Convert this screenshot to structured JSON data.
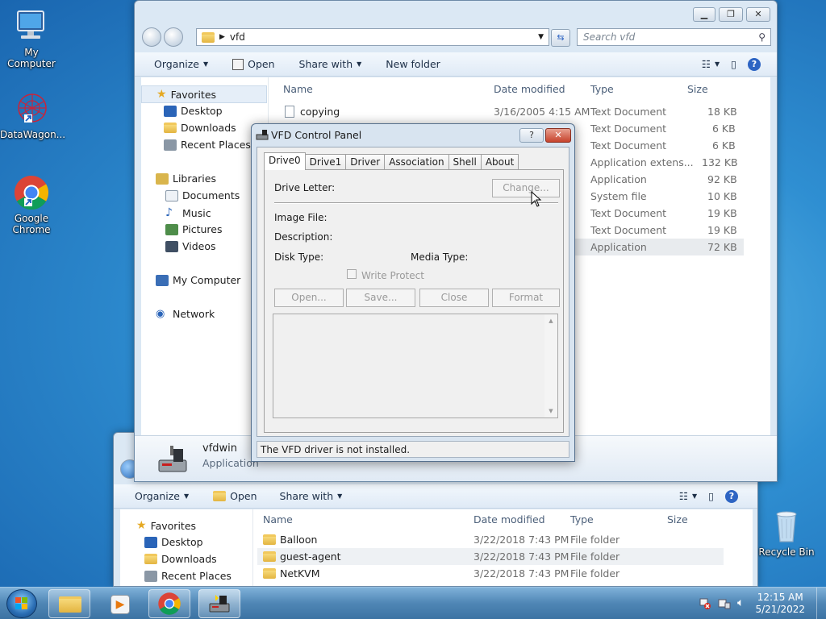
{
  "desktop": {
    "icons": [
      {
        "label": "My Computer"
      },
      {
        "label": "DataWagon..."
      },
      {
        "label": "Google Chrome"
      },
      {
        "label": "Recycle Bin"
      }
    ]
  },
  "explorer_top": {
    "address": "vfd",
    "search_placeholder": "Search vfd",
    "toolbar": {
      "organize": "Organize",
      "open": "Open",
      "share": "Share with",
      "new_folder": "New folder"
    },
    "nav": {
      "favorites": "Favorites",
      "desktop": "Desktop",
      "downloads": "Downloads",
      "recent": "Recent Places",
      "libraries": "Libraries",
      "documents": "Documents",
      "music": "Music",
      "pictures": "Pictures",
      "videos": "Videos",
      "my_computer": "My Computer",
      "network": "Network"
    },
    "columns": {
      "name": "Name",
      "date": "Date modified",
      "type": "Type",
      "size": "Size"
    },
    "rows": [
      {
        "name": "copying",
        "date": "3/16/2005 4:15 AM",
        "type": "Text Document",
        "size": "18 KB"
      },
      {
        "name": "",
        "date": "",
        "type": "Text Document",
        "size": "6 KB"
      },
      {
        "name": "",
        "date": "",
        "type": "Text Document",
        "size": "6 KB"
      },
      {
        "name": "",
        "date": "",
        "type": "Application extens...",
        "size": "132 KB"
      },
      {
        "name": "",
        "date": "",
        "type": "Application",
        "size": "92 KB"
      },
      {
        "name": "",
        "date": "",
        "type": "System file",
        "size": "10 KB"
      },
      {
        "name": "",
        "date": "",
        "type": "Text Document",
        "size": "19 KB"
      },
      {
        "name": "",
        "date": "",
        "type": "Text Document",
        "size": "19 KB"
      },
      {
        "name": "",
        "date": "",
        "type": "Application",
        "size": "72 KB"
      }
    ],
    "details": {
      "name": "vfdwin",
      "type": "Application"
    }
  },
  "explorer_bottom": {
    "toolbar": {
      "organize": "Organize",
      "open": "Open",
      "share": "Share with"
    },
    "nav": {
      "favorites": "Favorites",
      "desktop": "Desktop",
      "downloads": "Downloads",
      "recent": "Recent Places"
    },
    "columns": {
      "name": "Name",
      "date": "Date modified",
      "type": "Type",
      "size": "Size"
    },
    "rows": [
      {
        "name": "Balloon",
        "date": "3/22/2018 7:43 PM",
        "type": "File folder"
      },
      {
        "name": "guest-agent",
        "date": "3/22/2018 7:43 PM",
        "type": "File folder"
      },
      {
        "name": "NetKVM",
        "date": "3/22/2018 7:43 PM",
        "type": "File folder"
      }
    ]
  },
  "dialog": {
    "title": "VFD Control Panel",
    "help_btn": "?",
    "close_btn": "✕",
    "tabs": [
      "Drive0",
      "Drive1",
      "Driver",
      "Association",
      "Shell",
      "About"
    ],
    "drive_letter_label": "Drive Letter:",
    "change_btn": "Change...",
    "image_file_label": "Image File:",
    "description_label": "Description:",
    "disk_type_label": "Disk Type:",
    "media_type_label": "Media Type:",
    "write_protect_label": "Write Protect",
    "buttons": {
      "open": "Open...",
      "save": "Save...",
      "close": "Close",
      "format": "Format"
    },
    "status": "The VFD driver is not installed."
  },
  "taskbar": {
    "time": "12:15 AM",
    "date": "5/21/2022"
  }
}
